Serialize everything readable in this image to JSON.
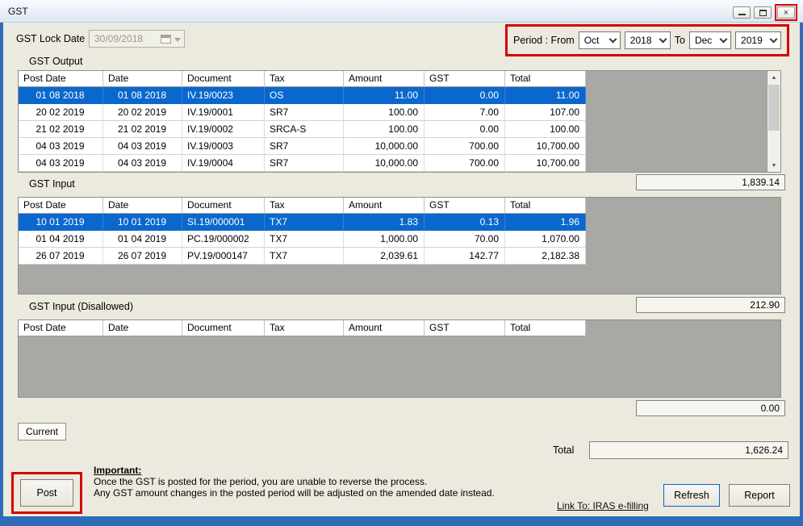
{
  "window": {
    "title": "GST",
    "controls": {
      "close_glyph": "×"
    }
  },
  "colors": {
    "annotation_red": "#d60000",
    "selection_blue": "#0a68cd",
    "window_border_blue": "#2e6cb8"
  },
  "header": {
    "lock_date_label": "GST Lock Date :",
    "lock_date_value": "30/09/2018",
    "period_label": "Period : From",
    "from_month": "Oct",
    "from_year": "2018",
    "to_label": "To",
    "to_month": "Dec",
    "to_year": "2019"
  },
  "columns": [
    "Post Date",
    "Date",
    "Document",
    "Tax",
    "Amount",
    "GST",
    "Total"
  ],
  "gst_output": {
    "title": "GST Output",
    "selected_index": 0,
    "rows": [
      [
        "01 08 2018",
        "01 08 2018",
        "IV.19/0023",
        "OS",
        "11.00",
        "0.00",
        "11.00"
      ],
      [
        "20 02 2019",
        "20 02 2019",
        "IV.19/0001",
        "SR7",
        "100.00",
        "7.00",
        "107.00"
      ],
      [
        "21 02 2019",
        "21 02 2019",
        "IV.19/0002",
        "SRCA-S",
        "100.00",
        "0.00",
        "100.00"
      ],
      [
        "04 03 2019",
        "04 03 2019",
        "IV.19/0003",
        "SR7",
        "10,000.00",
        "700.00",
        "10,700.00"
      ],
      [
        "04 03 2019",
        "04 03 2019",
        "IV.19/0004",
        "SR7",
        "10,000.00",
        "700.00",
        "10,700.00"
      ]
    ],
    "total": "1,839.14"
  },
  "gst_input": {
    "title": "GST Input",
    "selected_index": 0,
    "rows": [
      [
        "10 01 2019",
        "10 01 2019",
        "SI.19/000001",
        "TX7",
        "1.83",
        "0.13",
        "1.96"
      ],
      [
        "01 04 2019",
        "01 04 2019",
        "PC.19/000002",
        "TX7",
        "1,000.00",
        "70.00",
        "1,070.00"
      ],
      [
        "26 07 2019",
        "26 07 2019",
        "PV.19/000147",
        "TX7",
        "2,039.61",
        "142.77",
        "2,182.38"
      ]
    ],
    "total": "212.90"
  },
  "gst_disallowed": {
    "title": "GST Input (Disallowed)",
    "selected_index": -1,
    "rows": [],
    "total": "0.00"
  },
  "footer": {
    "tab_label": "Current",
    "total_label": "Total",
    "total_value": "1,626.24",
    "post_button": "Post",
    "important_title": "Important:",
    "important_lines": [
      "Once the GST is posted for the period, you are unable to reverse the process.",
      "Any GST amount changes in the posted period will be adjusted on the amended date instead."
    ],
    "link_label": "Link To: IRAS e-filling",
    "refresh_button": "Refresh",
    "report_button": "Report"
  }
}
